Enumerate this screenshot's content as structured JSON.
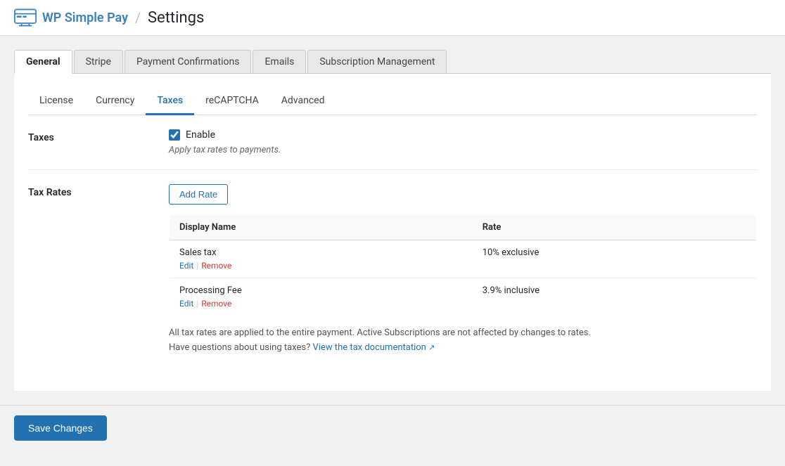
{
  "header": {
    "logo_text": "WP Simple Pay",
    "separator": "/",
    "page_title": "Settings"
  },
  "primary_tabs": {
    "items": [
      {
        "id": "general",
        "label": "General",
        "active": true
      },
      {
        "id": "stripe",
        "label": "Stripe",
        "active": false
      },
      {
        "id": "payment-confirmations",
        "label": "Payment Confirmations",
        "active": false
      },
      {
        "id": "emails",
        "label": "Emails",
        "active": false
      },
      {
        "id": "subscription-management",
        "label": "Subscription Management",
        "active": false
      }
    ]
  },
  "secondary_tabs": {
    "items": [
      {
        "id": "license",
        "label": "License",
        "active": false
      },
      {
        "id": "currency",
        "label": "Currency",
        "active": false
      },
      {
        "id": "taxes",
        "label": "Taxes",
        "active": true
      },
      {
        "id": "recaptcha",
        "label": "reCAPTCHA",
        "active": false
      },
      {
        "id": "advanced",
        "label": "Advanced",
        "active": false
      }
    ]
  },
  "taxes_section": {
    "label": "Taxes",
    "enable_label": "Enable",
    "description": "Apply tax rates to payments."
  },
  "tax_rates_section": {
    "label": "Tax Rates",
    "add_rate_label": "Add Rate",
    "table": {
      "col_display_name": "Display Name",
      "col_rate": "Rate",
      "rows": [
        {
          "name": "Sales tax",
          "rate": "10% exclusive",
          "edit_label": "Edit",
          "remove_label": "Remove"
        },
        {
          "name": "Processing Fee",
          "rate": "3.9% inclusive",
          "edit_label": "Edit",
          "remove_label": "Remove"
        }
      ]
    },
    "info_text_1": "All tax rates are applied to the entire payment. Active Subscriptions are not affected by changes to rates.",
    "info_text_2": "Have questions about using taxes?",
    "doc_link_label": "View the tax documentation",
    "external_icon": "↗"
  },
  "footer": {
    "save_label": "Save Changes"
  }
}
